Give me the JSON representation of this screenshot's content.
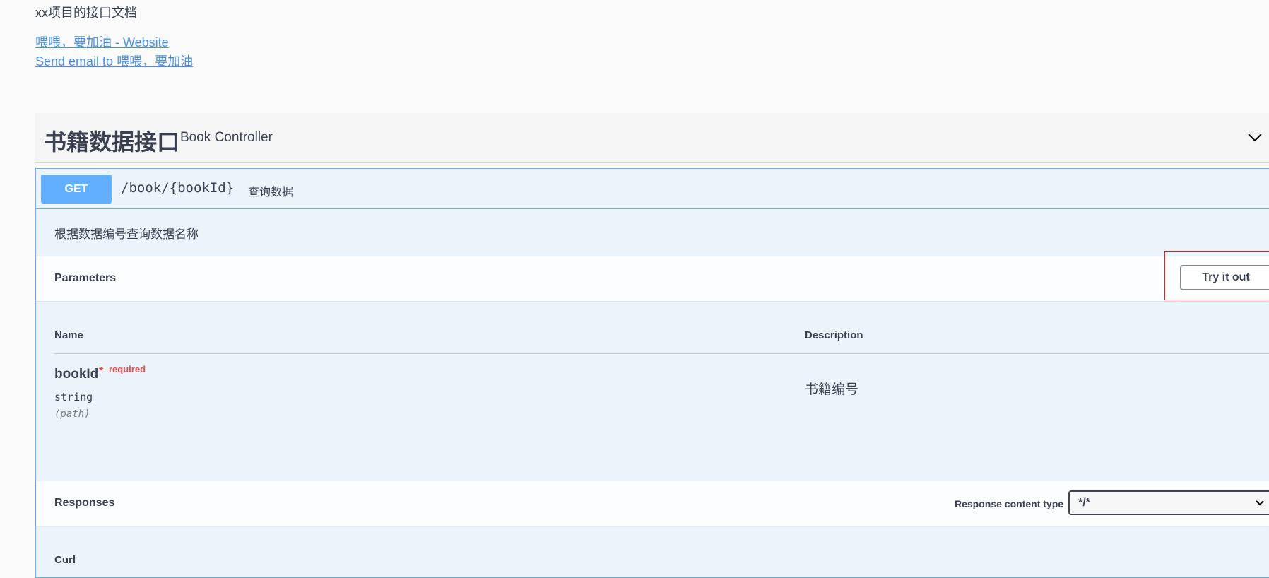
{
  "info": {
    "description": "xx项目的接口文档",
    "website_link": "喂喂，要加油 - Website",
    "email_link": "Send email to 喂喂，要加油"
  },
  "tag": {
    "name": "书籍数据接口",
    "description": "Book Controller",
    "toggle_icon": "chevron-down-icon"
  },
  "operation": {
    "method": "GET",
    "path": "/book/{bookId}",
    "summary": "查询数据",
    "description": "根据数据编号查询数据名称",
    "method_color": "#61affe"
  },
  "parameters": {
    "title": "Parameters",
    "try_button": "Try it out",
    "columns": {
      "name": "Name",
      "description": "Description"
    },
    "items": [
      {
        "name": "bookId",
        "required_star": "*",
        "required_label": "required",
        "type": "string",
        "in": "(path)",
        "description": "书籍编号"
      }
    ]
  },
  "responses": {
    "title": "Responses",
    "content_type_label": "Response content type",
    "content_type_value": "*/*",
    "curl_label": "Curl"
  },
  "colors": {
    "highlight_border": "#e02020",
    "link": "#4990e2",
    "required": "#e24b4b"
  }
}
